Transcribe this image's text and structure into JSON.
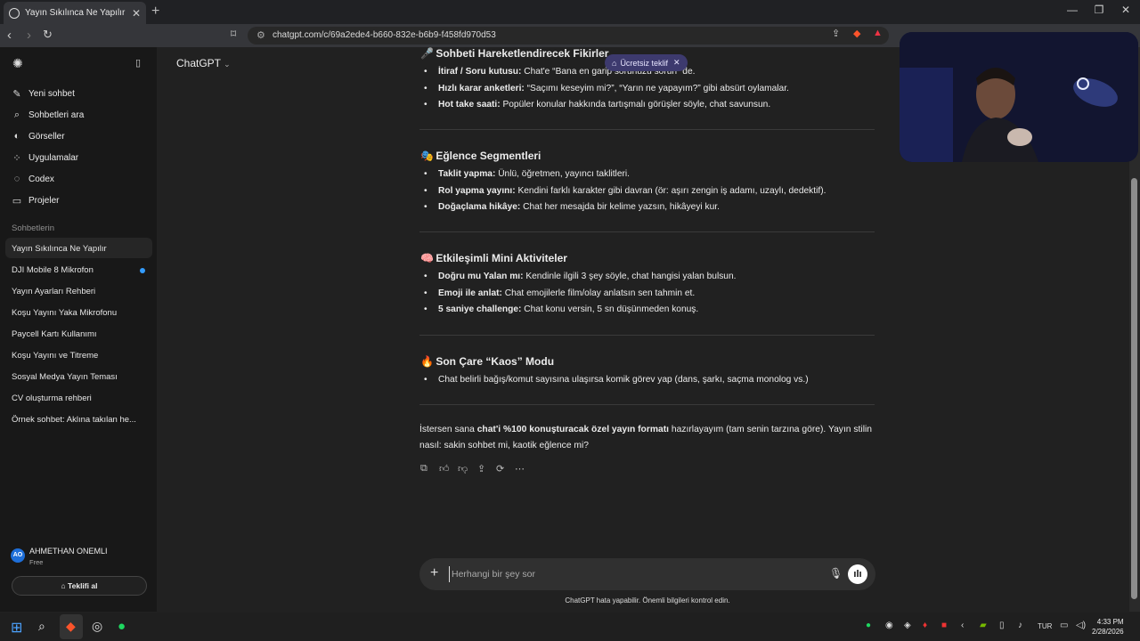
{
  "browser": {
    "tab_title": "Yayın Sıkılınca Ne Yapılır",
    "url": "chatgpt.com/c/69a2ede4-b660-832e-b6b9-f458fd970d53"
  },
  "sidebar": {
    "actions": [
      {
        "label": "Yeni sohbet",
        "icon": "edit-icon"
      },
      {
        "label": "Sohbetleri ara",
        "icon": "search-icon"
      },
      {
        "label": "Görseller",
        "icon": "image-icon"
      },
      {
        "label": "Uygulamalar",
        "icon": "apps-icon"
      },
      {
        "label": "Codex",
        "icon": "codex-icon"
      },
      {
        "label": "Projeler",
        "icon": "folder-icon"
      }
    ],
    "section_title": "Sohbetlerin",
    "chats": [
      "Yayın Sıkılınca Ne Yapılır",
      "DJI Mobile 8 Mikrofon",
      "Yayın Ayarları Rehberi",
      "Koşu Yayını Yaka Mikrofonu",
      "Paycell Kartı Kullanımı",
      "Koşu Yayını ve Titreme",
      "Sosyal Medya Yayın Teması",
      "CV oluşturma rehberi",
      "Örnek sohbet: Aklına takılan he..."
    ],
    "user": {
      "initials": "AO",
      "name": "AHMETHAN ONEMLI",
      "plan": "Free"
    },
    "upgrade_label": "Teklifi al"
  },
  "header": {
    "model": "ChatGPT",
    "offer_label": "Ücretsiz teklif"
  },
  "content": {
    "sections": [
      {
        "title": "Sohbeti Hareketlendirecek Fikirler",
        "emoji": "🎤",
        "items": [
          {
            "bold": "İtiraf / Soru kutusu:",
            "text": " Chat'e “Bana en garip sorunuzu sorun” de."
          },
          {
            "bold": "Hızlı karar anketleri:",
            "text": " “Saçımı keseyim mi?”, “Yarın ne yapayım?” gibi absürt oylamalar."
          },
          {
            "bold": "Hot take saati:",
            "text": " Popüler konular hakkında tartışmalı görüşler söyle, chat savunsun."
          }
        ]
      },
      {
        "title": "Eğlence Segmentleri",
        "emoji": "🎭",
        "items": [
          {
            "bold": "Taklit yapma:",
            "text": " Ünlü, öğretmen, yayıncı taklitleri."
          },
          {
            "bold": "Rol yapma yayını:",
            "text": " Kendini farklı karakter gibi davran (ör: aşırı zengin iş adamı, uzaylı, dedektif)."
          },
          {
            "bold": "Doğaçlama hikâye:",
            "text": " Chat her mesajda bir kelime yazsın, hikâyeyi kur."
          }
        ]
      },
      {
        "title": "Etkileşimli Mini Aktiviteler",
        "emoji": "🧠",
        "items": [
          {
            "bold": "Doğru mu Yalan mı:",
            "text": " Kendinle ilgili 3 şey söyle, chat hangisi yalan bulsun."
          },
          {
            "bold": "Emoji ile anlat:",
            "text": " Chat emojilerle film/olay anlatsın sen tahmin et."
          },
          {
            "bold": "5 saniye challenge:",
            "text": " Chat konu versin, 5 sn düşünmeden konuş."
          }
        ]
      },
      {
        "title": "Son Çare “Kaos” Modu",
        "emoji": "🔥",
        "items": [
          {
            "bold": "",
            "text": "Chat belirli bağış/komut sayısına ulaşırsa komik görev yap (dans, şarkı, saçma monolog vs.)"
          }
        ]
      }
    ],
    "closing": {
      "pre": "İstersen sana ",
      "bold": "chat'i %100 konuşturacak özel yayın formatı",
      "post": " hazırlayayım (tam senin tarzına göre). Yayın stilin nasıl: sakin sohbet mi, kaotik eğlence mi?"
    }
  },
  "composer": {
    "placeholder": "Herhangi bir şey sor"
  },
  "disclaimer": "ChatGPT hata yapabilir. Önemli bilgileri kontrol edin.",
  "taskbar": {
    "lang": "TUR",
    "time": "4:33 PM",
    "date": "2/28/2026"
  }
}
